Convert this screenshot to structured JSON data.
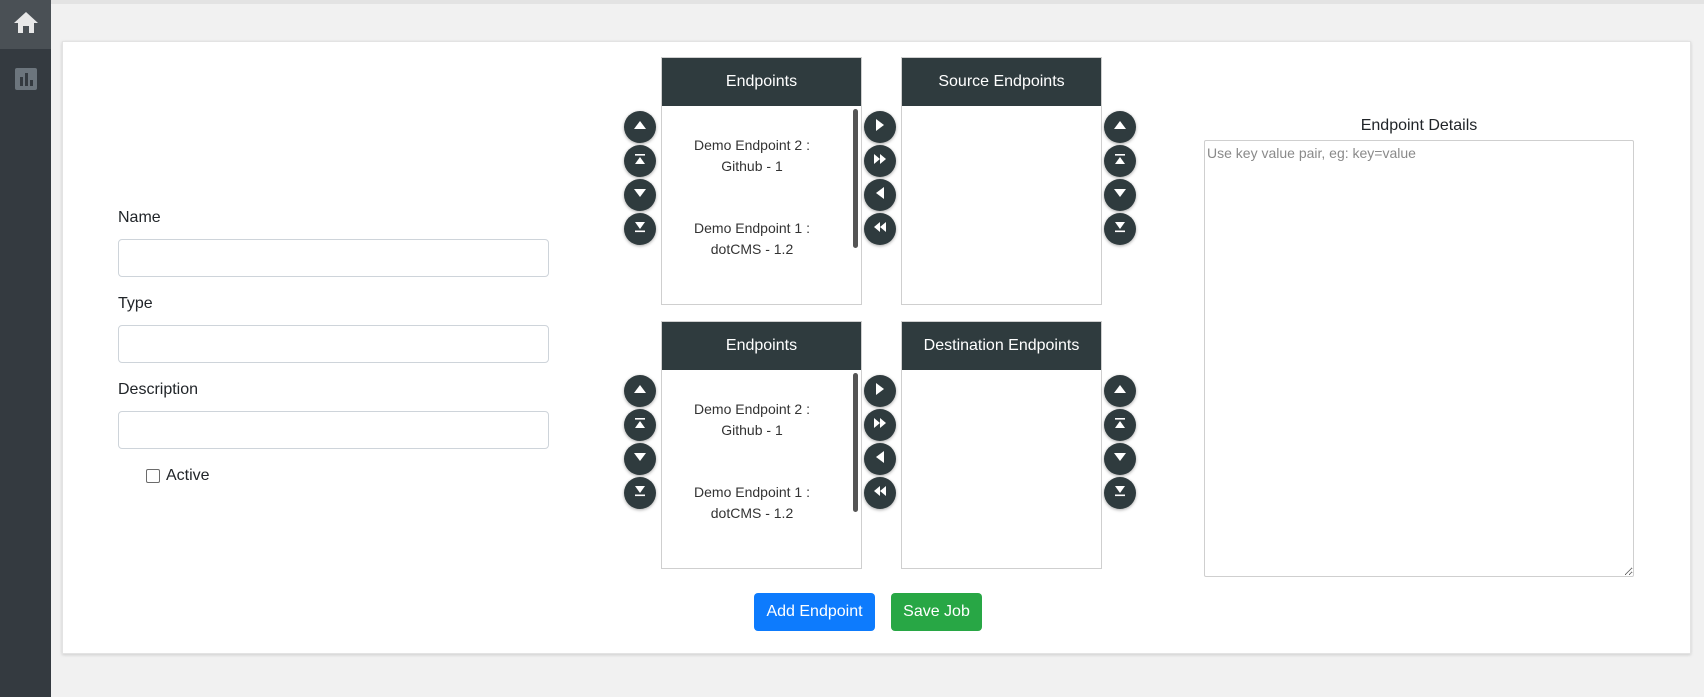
{
  "sidebar": {
    "home_icon": "home-icon",
    "chart_icon": "bar-chart-icon"
  },
  "form": {
    "name_label": "Name",
    "name_value": "",
    "type_label": "Type",
    "type_value": "",
    "description_label": "Description",
    "description_value": "",
    "active_label": "Active",
    "active_checked": false
  },
  "source": {
    "available": {
      "title": "Endpoints",
      "items": [
        "Demo Endpoint 2 :\nGithub - 1",
        "Demo Endpoint 1 :\ndotCMS - 1.2"
      ]
    },
    "selected": {
      "title": "Source Endpoints",
      "items": []
    }
  },
  "destination": {
    "available": {
      "title": "Endpoints",
      "items": [
        "Demo Endpoint 2 :\nGithub - 1",
        "Demo Endpoint 1 :\ndotCMS - 1.2"
      ]
    },
    "selected": {
      "title": "Destination Endpoints",
      "items": []
    }
  },
  "details": {
    "title": "Endpoint Details",
    "placeholder": "Use key value pair, eg: key=value",
    "value": ""
  },
  "actions": {
    "add_label": "Add Endpoint",
    "save_label": "Save Job"
  },
  "colors": {
    "sidebar": "#343a40",
    "header_dark": "#2f3b3e",
    "primary": "#0d7bfd",
    "success": "#28a745"
  }
}
